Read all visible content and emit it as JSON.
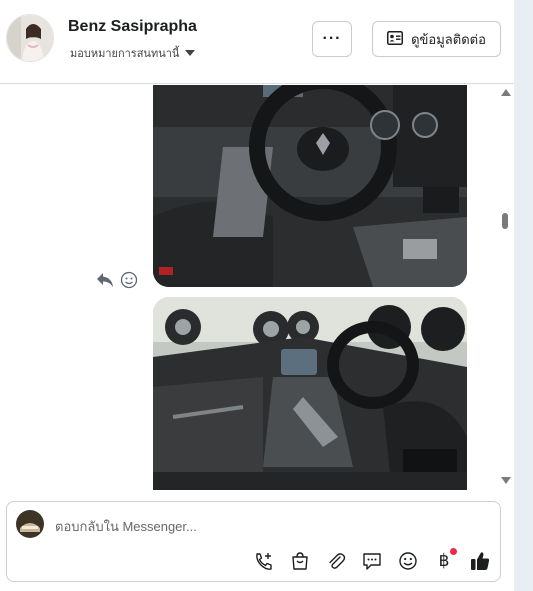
{
  "header": {
    "contact_name": "Benz Sasiprapha",
    "assign_label": "มอบหมายการสนทนานี้",
    "more_label": "···",
    "contact_info_label": "ดูข้อมูลติดต่อ"
  },
  "composer": {
    "placeholder": "ตอบกลับใน Messenger...",
    "currency_symbol": "฿"
  },
  "icons": [
    "caret-down-icon",
    "contact-card-icon",
    "reply-icon",
    "emoji-icon",
    "call-add-icon",
    "shopping-bag-icon",
    "paperclip-icon",
    "chat-bubble-icon",
    "baht-icon",
    "like-thumb-icon"
  ],
  "colors": {
    "like": "#1c1e21",
    "notification_dot": "#f02849",
    "border": "#c9ccd1"
  }
}
